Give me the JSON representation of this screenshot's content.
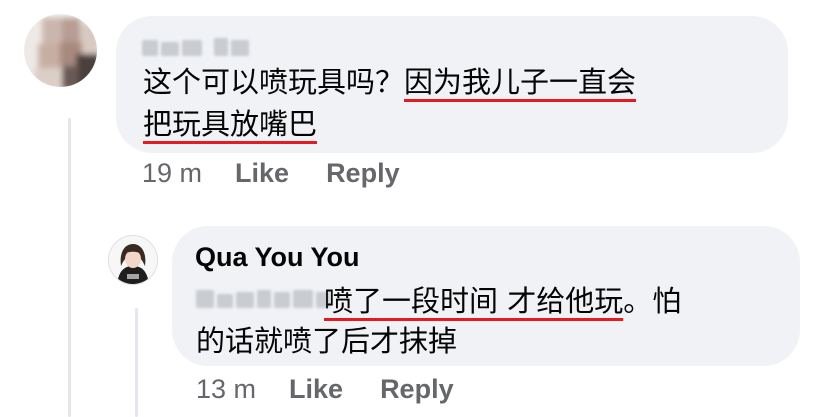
{
  "comment": {
    "author": "",
    "lines": [
      {
        "plain": "这个可以喷玩具吗？",
        "underlined": "因为我儿子一直会"
      },
      {
        "plain": "",
        "underlined": "把玩具放嘴巴"
      }
    ],
    "time": "19 m",
    "like_label": "Like",
    "reply_label": "Reply"
  },
  "reply": {
    "author": "Qua You You",
    "lines": [
      {
        "plain_before": "",
        "underlined": "喷了一段时间 才给他玩",
        "plain_after": "。怕"
      },
      {
        "plain_before": "的话就喷了后才抹掉",
        "underlined": "",
        "plain_after": ""
      }
    ],
    "time": "13 m",
    "like_label": "Like",
    "reply_label": "Reply"
  },
  "colors": {
    "bubble": "#f0f2f5",
    "underline": "#e41b23",
    "meta_text": "#65676b",
    "thread_line": "#e4e6eb"
  }
}
